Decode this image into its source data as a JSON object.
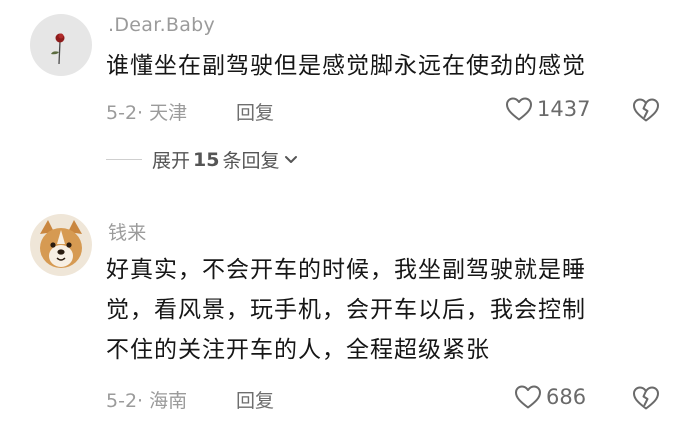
{
  "comments": [
    {
      "username": ".Dear.Baby",
      "avatar": "rose-avatar",
      "lines": [
        "谁懂坐在副驾驶但是感觉脚永远在使劲的感觉"
      ],
      "meta": "5-2· 天津",
      "reply_label": "回复",
      "likes": "1437",
      "replies": {
        "prefix": "展开",
        "count": "15",
        "suffix": "条回复"
      }
    },
    {
      "username": "钱来",
      "avatar": "dog-avatar",
      "lines": [
        "好真实，不会开车的时候，我坐副驾驶就是睡",
        "觉，看风景，玩手机，会开车以后，我会控制",
        "不住的关注开车的人，全程超级紧张"
      ],
      "meta": "5-2· 海南",
      "reply_label": "回复",
      "likes": "686"
    }
  ],
  "icons": {
    "like": "heart-outline-icon",
    "dislike": "broken-heart-icon",
    "expand": "chevron-down-icon"
  },
  "colors": {
    "meta_gray": "#9b9b9b",
    "body_text": "#161616"
  }
}
